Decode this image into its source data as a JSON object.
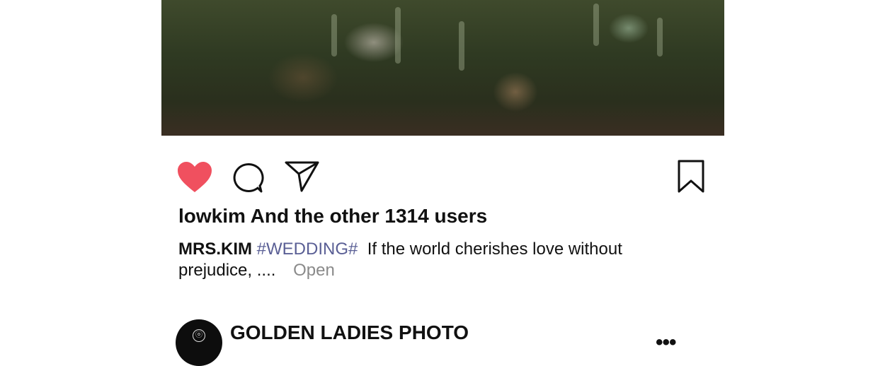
{
  "post": {
    "image_alt": "Wedding photo reflection",
    "actions": {
      "like_icon": "heart-filled-icon",
      "comment_icon": "comment-icon",
      "share_icon": "paper-plane-icon",
      "save_icon": "bookmark-icon",
      "like_color": "#f0505f"
    },
    "likes_text": "lowkim And the other 1314 users",
    "caption": {
      "username": "MRS.KIM",
      "hashtag": "#WEDDING#",
      "text": "If the world cherishes love without prejudice, ....",
      "open_label": "Open"
    }
  },
  "next_post": {
    "author": "GOLDEN LADIES PHOTO",
    "more_label": "•••"
  }
}
